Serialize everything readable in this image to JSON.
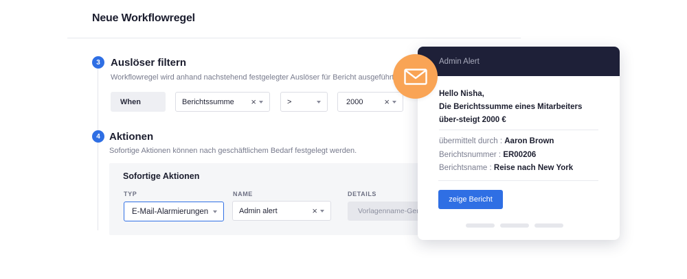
{
  "page": {
    "title": "Neue Workflowregel"
  },
  "trigger_section": {
    "step": "3",
    "title": "Auslöser filtern",
    "description": "Workflowregel wird anhand nachstehend festgelegter Auslöser für Bericht ausgeführt.",
    "when_label": "When",
    "field_value": "Berichtssumme",
    "operator_value": ">",
    "amount_value": "2000"
  },
  "actions_section": {
    "step": "4",
    "title": "Aktionen",
    "description": "Sofortige Aktionen können nach geschäftlichem Bedarf festgelegt werden.",
    "panel_title": "Sofortige Aktionen",
    "columns": {
      "type": "TYP",
      "name": "NAME",
      "details": "DETAILS"
    },
    "type_value": "E-Mail-Alarmierungen",
    "name_value": "Admin alert",
    "details_value": "Vorlagenname-Germ"
  },
  "alert_card": {
    "header": "Admin Alert",
    "greeting": "Hello Nisha,",
    "message": "Die Berichtssumme eines Mitarbeiters über-steigt 2000 €",
    "rows": [
      {
        "label": "übermittelt durch :",
        "value": "Aaron Brown"
      },
      {
        "label": "Berichtsnummer :",
        "value": "ER00206"
      },
      {
        "label": "Berichtsname :",
        "value": "Reise nach New York"
      }
    ],
    "button_label": "zeige Bericht"
  },
  "icons": {
    "mail": "mail-icon",
    "clear": "clear-icon",
    "dropdown": "chevron-down-icon"
  },
  "colors": {
    "accent": "#2f6fe4",
    "header_dark": "#1e2038",
    "mail_orange": "#f9a455"
  }
}
